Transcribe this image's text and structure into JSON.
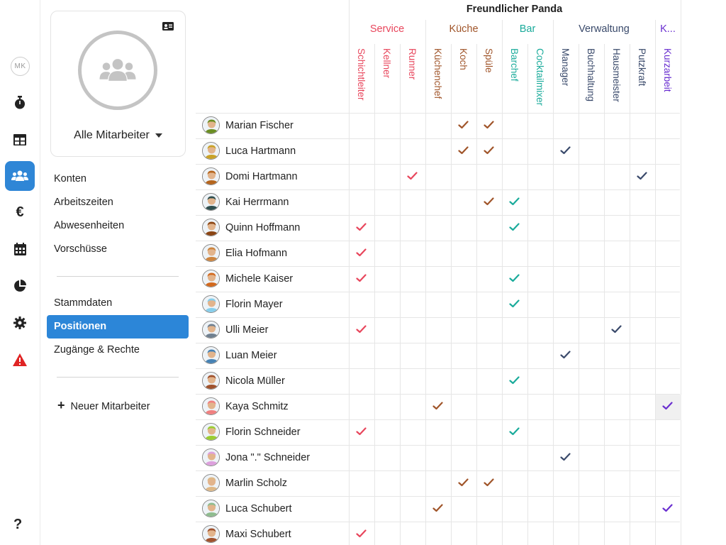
{
  "rail": {
    "initials": "MK",
    "help": "?"
  },
  "sidebar": {
    "all_employees": "Alle Mitarbeiter",
    "menu1": [
      "Konten",
      "Arbeitszeiten",
      "Abwesenheiten",
      "Vorschüsse"
    ],
    "menu2": [
      "Stammdaten",
      "Positionen",
      "Zugänge & Rechte"
    ],
    "active_item": "Positionen",
    "new_employee": "Neuer Mitarbeiter"
  },
  "grid": {
    "company": "Freundlicher Panda",
    "groups": [
      {
        "name": "Service",
        "color": "#e8465c",
        "positions": [
          "Schichtleiter",
          "Kellner",
          "Runner"
        ]
      },
      {
        "name": "Küche",
        "color": "#a0552a",
        "positions": [
          "Küchenchef",
          "Koch",
          "Spüle"
        ]
      },
      {
        "name": "Bar",
        "color": "#1aab9b",
        "positions": [
          "Barchef",
          "Cocktailmixer"
        ]
      },
      {
        "name": "Verwaltung",
        "color": "#3a4a6b",
        "positions": [
          "Manager",
          "Buchhaltung",
          "Hausmeister",
          "Putzkraft"
        ]
      },
      {
        "name": "K...",
        "color": "#6a2fd0",
        "positions": [
          "Kurzarbeit"
        ]
      }
    ],
    "employees": [
      {
        "name": "Marian Fischer",
        "checks": [
          4,
          5
        ]
      },
      {
        "name": "Luca Hartmann",
        "checks": [
          4,
          5,
          8
        ]
      },
      {
        "name": "Domi Hartmann",
        "checks": [
          2,
          11
        ]
      },
      {
        "name": "Kai Herrmann",
        "checks": [
          5,
          6
        ]
      },
      {
        "name": "Quinn Hoffmann",
        "checks": [
          0,
          6
        ]
      },
      {
        "name": "Elia Hofmann",
        "checks": [
          0
        ]
      },
      {
        "name": "Michele Kaiser",
        "checks": [
          0,
          6
        ]
      },
      {
        "name": "Florin Mayer",
        "checks": [
          6
        ]
      },
      {
        "name": "Ulli Meier",
        "checks": [
          0,
          10
        ]
      },
      {
        "name": "Luan Meier",
        "checks": [
          8
        ]
      },
      {
        "name": "Nicola Müller",
        "checks": [
          6
        ]
      },
      {
        "name": "Kaya Schmitz",
        "checks": [
          3,
          12
        ]
      },
      {
        "name": "Florin Schneider",
        "checks": [
          0,
          6
        ]
      },
      {
        "name": "Jona \".\" Schneider",
        "checks": [
          8
        ]
      },
      {
        "name": "Marlin Scholz",
        "checks": [
          4,
          5
        ]
      },
      {
        "name": "Luca Schubert",
        "checks": [
          3,
          12
        ]
      },
      {
        "name": "Maxi Schubert",
        "checks": [
          0
        ]
      }
    ]
  }
}
